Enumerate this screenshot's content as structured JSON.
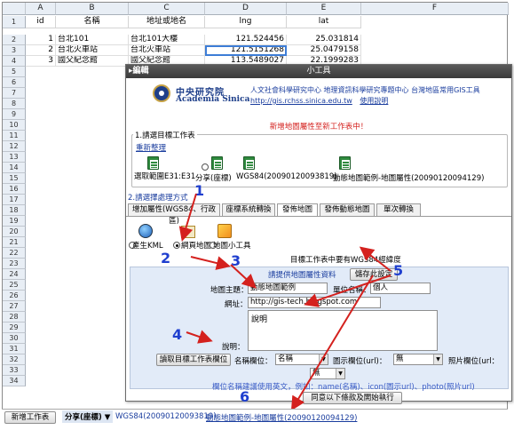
{
  "sheet": {
    "columns": [
      "A",
      "B",
      "C",
      "D",
      "E",
      "F"
    ],
    "header_row": [
      "id",
      "名稱",
      "地址或地名",
      "lng",
      "lat"
    ],
    "row_numbers": [
      "1",
      "2",
      "3",
      "4",
      "5",
      "6",
      "7",
      "8",
      "9",
      "10",
      "11",
      "12",
      "13",
      "14",
      "15",
      "16",
      "17",
      "18",
      "19",
      "20",
      "21",
      "22",
      "23",
      "24",
      "25",
      "26",
      "27",
      "28",
      "29",
      "30",
      "31",
      "32",
      "33",
      "34"
    ],
    "rows": [
      {
        "id": "1",
        "name": "台北101",
        "addr": "台北101大樓",
        "lng": "121.524456",
        "lat": "25.031814"
      },
      {
        "id": "2",
        "name": "台北火車站",
        "addr": "台北火車站",
        "lng": "121.5151268",
        "lat": "25.0479158"
      },
      {
        "id": "3",
        "name": "國父紀念館",
        "addr": "國父紀念館",
        "lng": "113.5489027",
        "lat": "22.1999283"
      }
    ]
  },
  "dialog": {
    "edit_label": "▸編輯",
    "title": "小工具",
    "brand_cn": "中央研究院",
    "brand_en": "Academia Sinica",
    "center_text": "人文社會科學研究中心 地理資訊科學研究專題中心 台灣地區常用GIS工具",
    "url": "http://gis.rchss.sinica.edu.tw",
    "usage_link": "使用說明",
    "new_sheet_msg": "新增地圖屬性至新工作表中！",
    "section1_title": "1.請選目標工作表",
    "reorganize_link": "重新整理",
    "sheet_options": [
      {
        "label": "選取範圍E31:E31",
        "checked": false
      },
      {
        "label": "分享(座標)",
        "checked": true
      },
      {
        "label": "WGS84(20090120093819)",
        "checked": false
      },
      {
        "label": "動態地圖範例-地圖屬性(20090120094129)",
        "checked": false
      }
    ],
    "section2_title": "2.請選擇處理方式",
    "tabs": [
      "增加屬性(WGS84、行政區)",
      "座標系統轉換",
      "發佈地圖",
      "發佈動態地圖",
      "單次轉換"
    ],
    "active_tab": "發佈地圖",
    "publish_options": [
      {
        "label": "產生KML",
        "checked": false
      },
      {
        "label": "網頁地圖",
        "checked": true
      },
      {
        "label": "地圖小工具",
        "checked": false
      }
    ],
    "wgs84_note": "目標工作表中要有WGS84經緯度",
    "provide_attr": "請提供地圖屬性資料",
    "save_settings": "儲存此設定",
    "map_subject_label": "地圖主題：",
    "map_subject_value": "動態地圖範例",
    "author_label": "單位名稱：",
    "author_value": "個人",
    "website_label": "網址：",
    "website_value": "http://gis-tech.blogspot.com",
    "desc_label_top": "說明",
    "desc_label_left": "說明：",
    "read_fields_btn": "讀取目標工作表欄位",
    "name_field_label": "名稱欄位：",
    "name_field_value": "名稱",
    "icon_field_label": "圖示欄位(url)：",
    "icon_field_value": "無",
    "photo_field_label": "照片欄位(url：",
    "photo_field_value": "無",
    "extra_select_value": "無",
    "field_hint": "欄位名稱建議使用英文，例如：name(名稱)、icon(圖示url)、photo(照片url)",
    "submit_btn": "同意以下條款及開始執行"
  },
  "annotations": [
    "1",
    "2",
    "3",
    "4",
    "5",
    "6"
  ],
  "bottom_bar": {
    "new_sheet_btn": "新增工作表",
    "tabs": [
      "分享(座標) ▼",
      "WGS84(20090120093819)",
      "動態地圖範例-地圖屬性(20090120094129)"
    ]
  },
  "colors": {
    "annotation_blue": "#1f3fcf",
    "arrow_red": "#d4211e",
    "panel_blue": "#e2ebf8"
  }
}
